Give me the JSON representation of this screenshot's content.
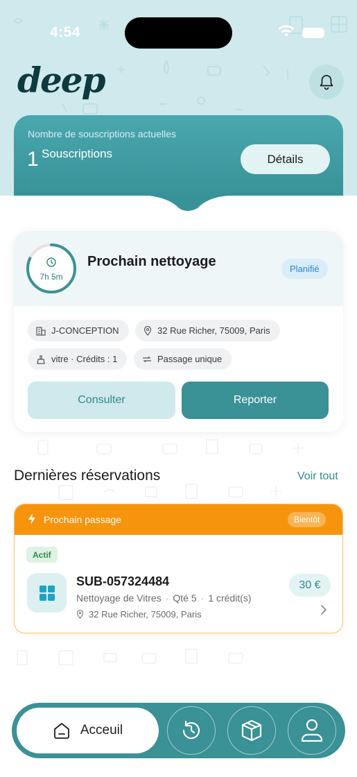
{
  "status_bar": {
    "time": "4:54"
  },
  "header": {
    "logo": "deep",
    "notification_icon": "bell-icon"
  },
  "subscriptions": {
    "label": "Nombre de souscriptions actuelles",
    "count": "1",
    "count_label": "Souscriptions",
    "details_button": "Détails"
  },
  "next_cleaning": {
    "countdown": "7h 5m",
    "countdown_progress": 0.82,
    "title": "Prochain nettoyage",
    "status": "Planifié",
    "company": "J-CONCEPTION",
    "address": "32 Rue Richer, 75009, Paris",
    "service": "vitre · Crédits : 1",
    "frequency": "Passage unique",
    "consult_button": "Consulter",
    "report_button": "Reporter"
  },
  "recent": {
    "title": "Dernières réservations",
    "see_all": "Voir tout",
    "reservation": {
      "banner_label": "Prochain passage",
      "banner_badge": "Bientôt",
      "state": "Actif",
      "id": "SUB-057324484",
      "service": "Nettoyage de Vitres",
      "quantity": "Qté 5",
      "credits": "1 crédit(s)",
      "address": "32 Rue Richer, 75009, Paris",
      "price": "30 €"
    }
  },
  "tabbar": {
    "home": "Acceuil"
  },
  "colors": {
    "teal": "#3a9196",
    "teal_light": "#cfe9ec",
    "orange": "#f7940e",
    "planned_blue": "#2c86c7",
    "active_green": "#2e8a47"
  }
}
